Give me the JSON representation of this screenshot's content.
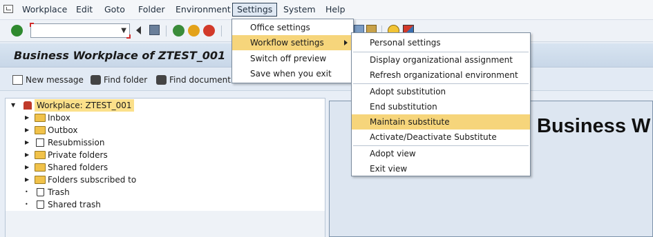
{
  "menubar": {
    "items": [
      "Workplace",
      "Edit",
      "Goto",
      "Folder",
      "Environment",
      "Settings",
      "System",
      "Help"
    ],
    "active": "Settings"
  },
  "title": "Business Workplace of ZTEST_001",
  "app_toolbar": {
    "new_message": "New message",
    "find_folder": "Find folder",
    "find_document": "Find document"
  },
  "tree": {
    "root": "Workplace: ZTEST_001",
    "items": [
      {
        "label": "Inbox",
        "icon": "inbox-folder-icon"
      },
      {
        "label": "Outbox",
        "icon": "outbox-folder-icon"
      },
      {
        "label": "Resubmission",
        "icon": "resubmission-icon"
      },
      {
        "label": "Private folders",
        "icon": "private-folder-icon"
      },
      {
        "label": "Shared folders",
        "icon": "shared-folder-icon"
      },
      {
        "label": "Folders subscribed to",
        "icon": "subscribed-folder-icon"
      },
      {
        "label": "Trash",
        "icon": "trash-icon"
      },
      {
        "label": "Shared trash",
        "icon": "shared-trash-icon"
      }
    ]
  },
  "right_panel": {
    "heading": "Business W"
  },
  "settings_menu": {
    "items": [
      "Office settings",
      "Workflow settings",
      "Switch off preview",
      "Save when you exit"
    ]
  },
  "workflow_submenu": {
    "items": [
      "Personal settings",
      "Display organizational assignment",
      "Refresh organizational environment",
      "Adopt substitution",
      "End substitution",
      "Maintain substitute",
      "Activate/Deactivate Substitute",
      "Adopt view",
      "Exit view"
    ],
    "highlighted": "Maintain substitute"
  },
  "colors": {
    "highlight": "#f6d57b",
    "root_highlight": "#fbe08a",
    "title_bg": "#c8d7e8"
  }
}
